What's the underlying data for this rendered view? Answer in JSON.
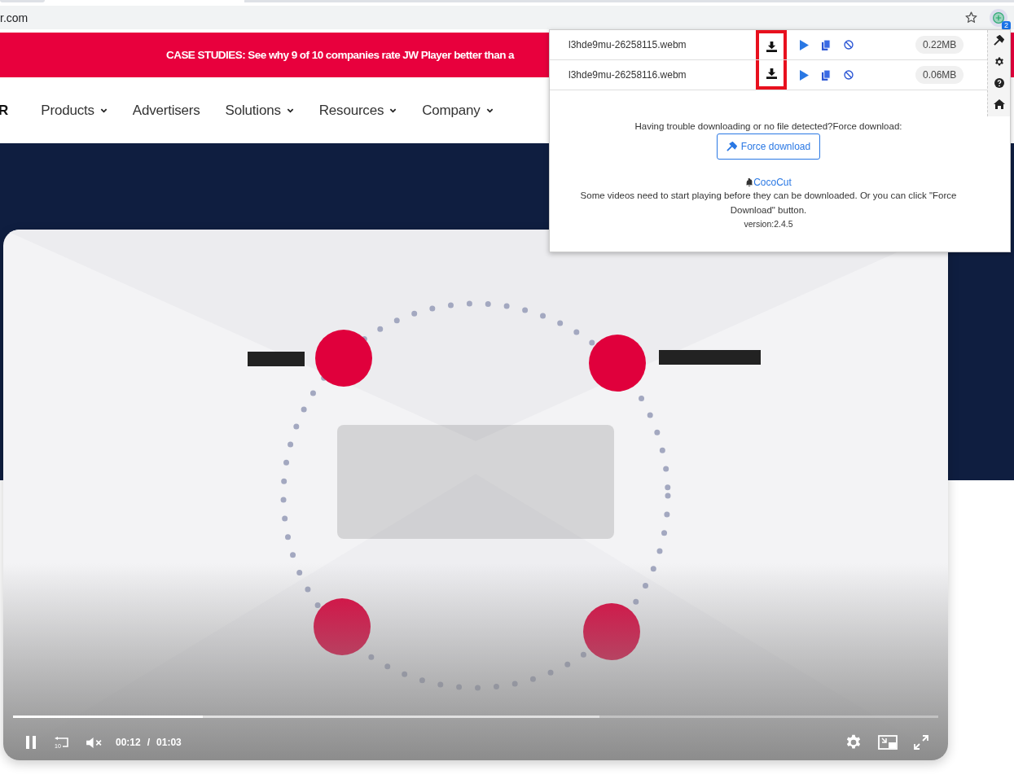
{
  "browser": {
    "address": "r.com",
    "extension_badge": "2"
  },
  "banner": {
    "text": "CASE STUDIES: See why 9 of 10 companies rate JW Player better than a"
  },
  "nav": {
    "logo_fragment": "R",
    "items": [
      {
        "label": "Products",
        "dropdown": true
      },
      {
        "label": "Advertisers",
        "dropdown": false
      },
      {
        "label": "Solutions",
        "dropdown": true
      },
      {
        "label": "Resources",
        "dropdown": true
      },
      {
        "label": "Company",
        "dropdown": true
      }
    ]
  },
  "video": {
    "playing": true,
    "muted": true,
    "replay_label": "10",
    "current_time": "00:12",
    "separator": "/",
    "duration": "01:03",
    "progress": {
      "level": 0.205
    },
    "buffer": {
      "level": 0.634
    }
  },
  "popup": {
    "files": [
      {
        "name": "l3hde9mu-26258115.webm",
        "size": "0.22MB",
        "highlighted": true
      },
      {
        "name": "l3hde9mu-26258116.webm",
        "size": "0.06MB",
        "highlighted": true
      }
    ],
    "trouble_text": "Having trouble downloading or no file detected?Force download:",
    "force_button": "Force download",
    "brand_link": "CocoCut",
    "note": "Some videos need to start playing before they can be downloaded. Or you can click \"Force Download\" button.",
    "version": "version:2.4.5",
    "side_tools": [
      {
        "kind": "hammer"
      },
      {
        "kind": "gear"
      },
      {
        "kind": "help"
      },
      {
        "kind": "home"
      }
    ]
  }
}
